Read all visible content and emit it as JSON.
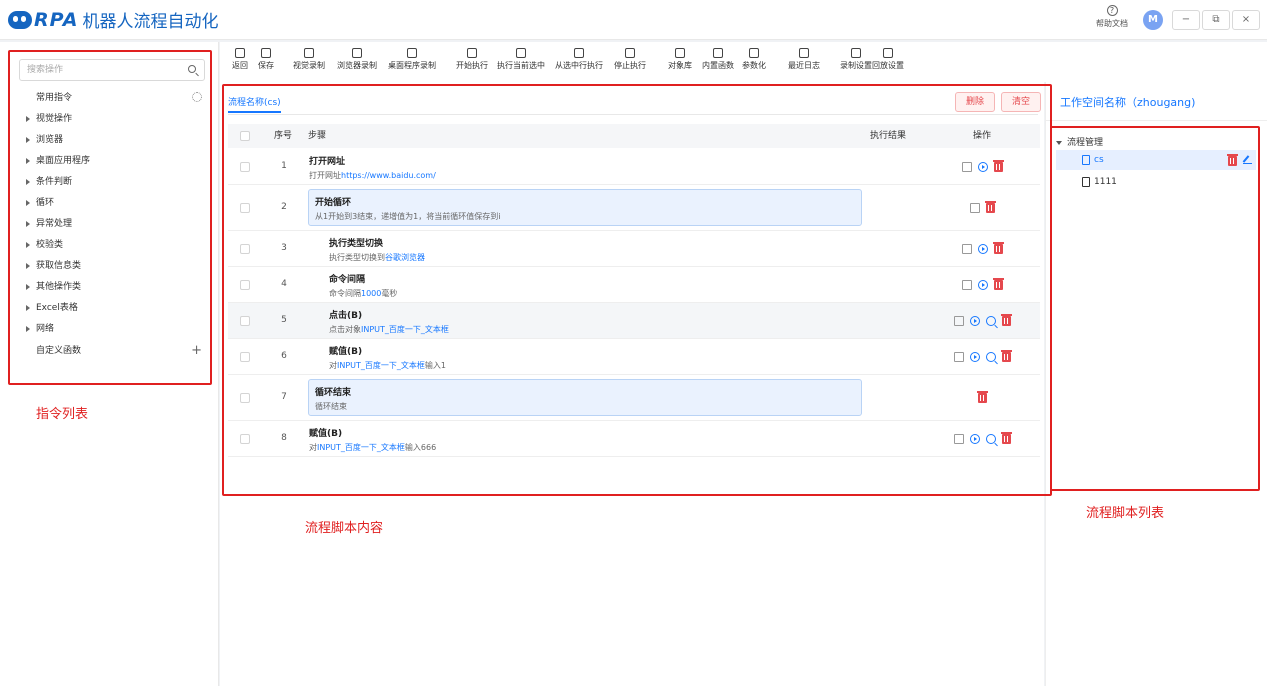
{
  "app": {
    "logo_text": "RPA",
    "title": "机器人流程自动化"
  },
  "header": {
    "help_label": "帮助文档",
    "help_icon": "?",
    "avatar_initial": "M",
    "minimize_glyph": "−",
    "restore_glyph": "⧉",
    "close_glyph": "×"
  },
  "sidebar": {
    "search_placeholder": "搜索操作",
    "common_label": "常用指令",
    "categories": [
      "视觉操作",
      "浏览器",
      "桌面应用程序",
      "条件判断",
      "循环",
      "异常处理",
      "校验类",
      "获取信息类",
      "其他操作类",
      "Excel表格",
      "网络"
    ],
    "custom_label": "自定义函数"
  },
  "toolbar": {
    "items": [
      "返回",
      "保存",
      "视觉录制",
      "浏览器录制",
      "桌面程序录制",
      "开始执行",
      "执行当前选中",
      "从选中行执行",
      "停止执行",
      "对象库",
      "内置函数",
      "参数化",
      "最近日志",
      "录制设置",
      "回放设置"
    ]
  },
  "flow": {
    "name_label": "流程名称(cs)",
    "delete_label": "删除",
    "clear_label": "清空",
    "columns": {
      "index": "序号",
      "step": "步骤",
      "result": "执行结果",
      "action": "操作"
    },
    "rows": [
      {
        "index": "1",
        "title": "打开网址",
        "desc_pre": "打开网址",
        "desc_link": "https://www.baidu.com/",
        "desc_post": ""
      },
      {
        "index": "2",
        "title": "开始循环",
        "desc_pre": "从1开始到3结束，递增值为1，将当前循环值保存到i",
        "desc_link": "",
        "desc_post": ""
      },
      {
        "index": "3",
        "title": "执行类型切换",
        "desc_pre": "执行类型切换到",
        "desc_link": "谷歌浏览器",
        "desc_post": ""
      },
      {
        "index": "4",
        "title": "命令间隔",
        "desc_pre": "命令间隔",
        "desc_link": "1000",
        "desc_post": "毫秒"
      },
      {
        "index": "5",
        "title": "点击(B)",
        "desc_pre": "点击对象",
        "desc_link": "INPUT_百度一下_文本框",
        "desc_post": ""
      },
      {
        "index": "6",
        "title": "赋值(B)",
        "desc_pre": "对",
        "desc_link": "INPUT_百度一下_文本框",
        "desc_post": "输入1"
      },
      {
        "index": "7",
        "title": "循环结束",
        "desc_pre": "循环结束",
        "desc_link": "",
        "desc_post": ""
      },
      {
        "index": "8",
        "title": "赋值(B)",
        "desc_pre": "对",
        "desc_link": "INPUT_百度一下_文本框",
        "desc_post": "输入666"
      }
    ]
  },
  "workspace": {
    "title": "工作空间名称（zhougang)",
    "root_label": "流程管理",
    "files": [
      "cs",
      "1111"
    ]
  },
  "annotations": {
    "command_list": "指令列表",
    "script_content": "流程脚本内容",
    "script_list": "流程脚本列表"
  },
  "colors": {
    "accent": "#1677ff",
    "danger": "#e5484d",
    "annotation": "#e02020",
    "brand": "#1565c0"
  }
}
